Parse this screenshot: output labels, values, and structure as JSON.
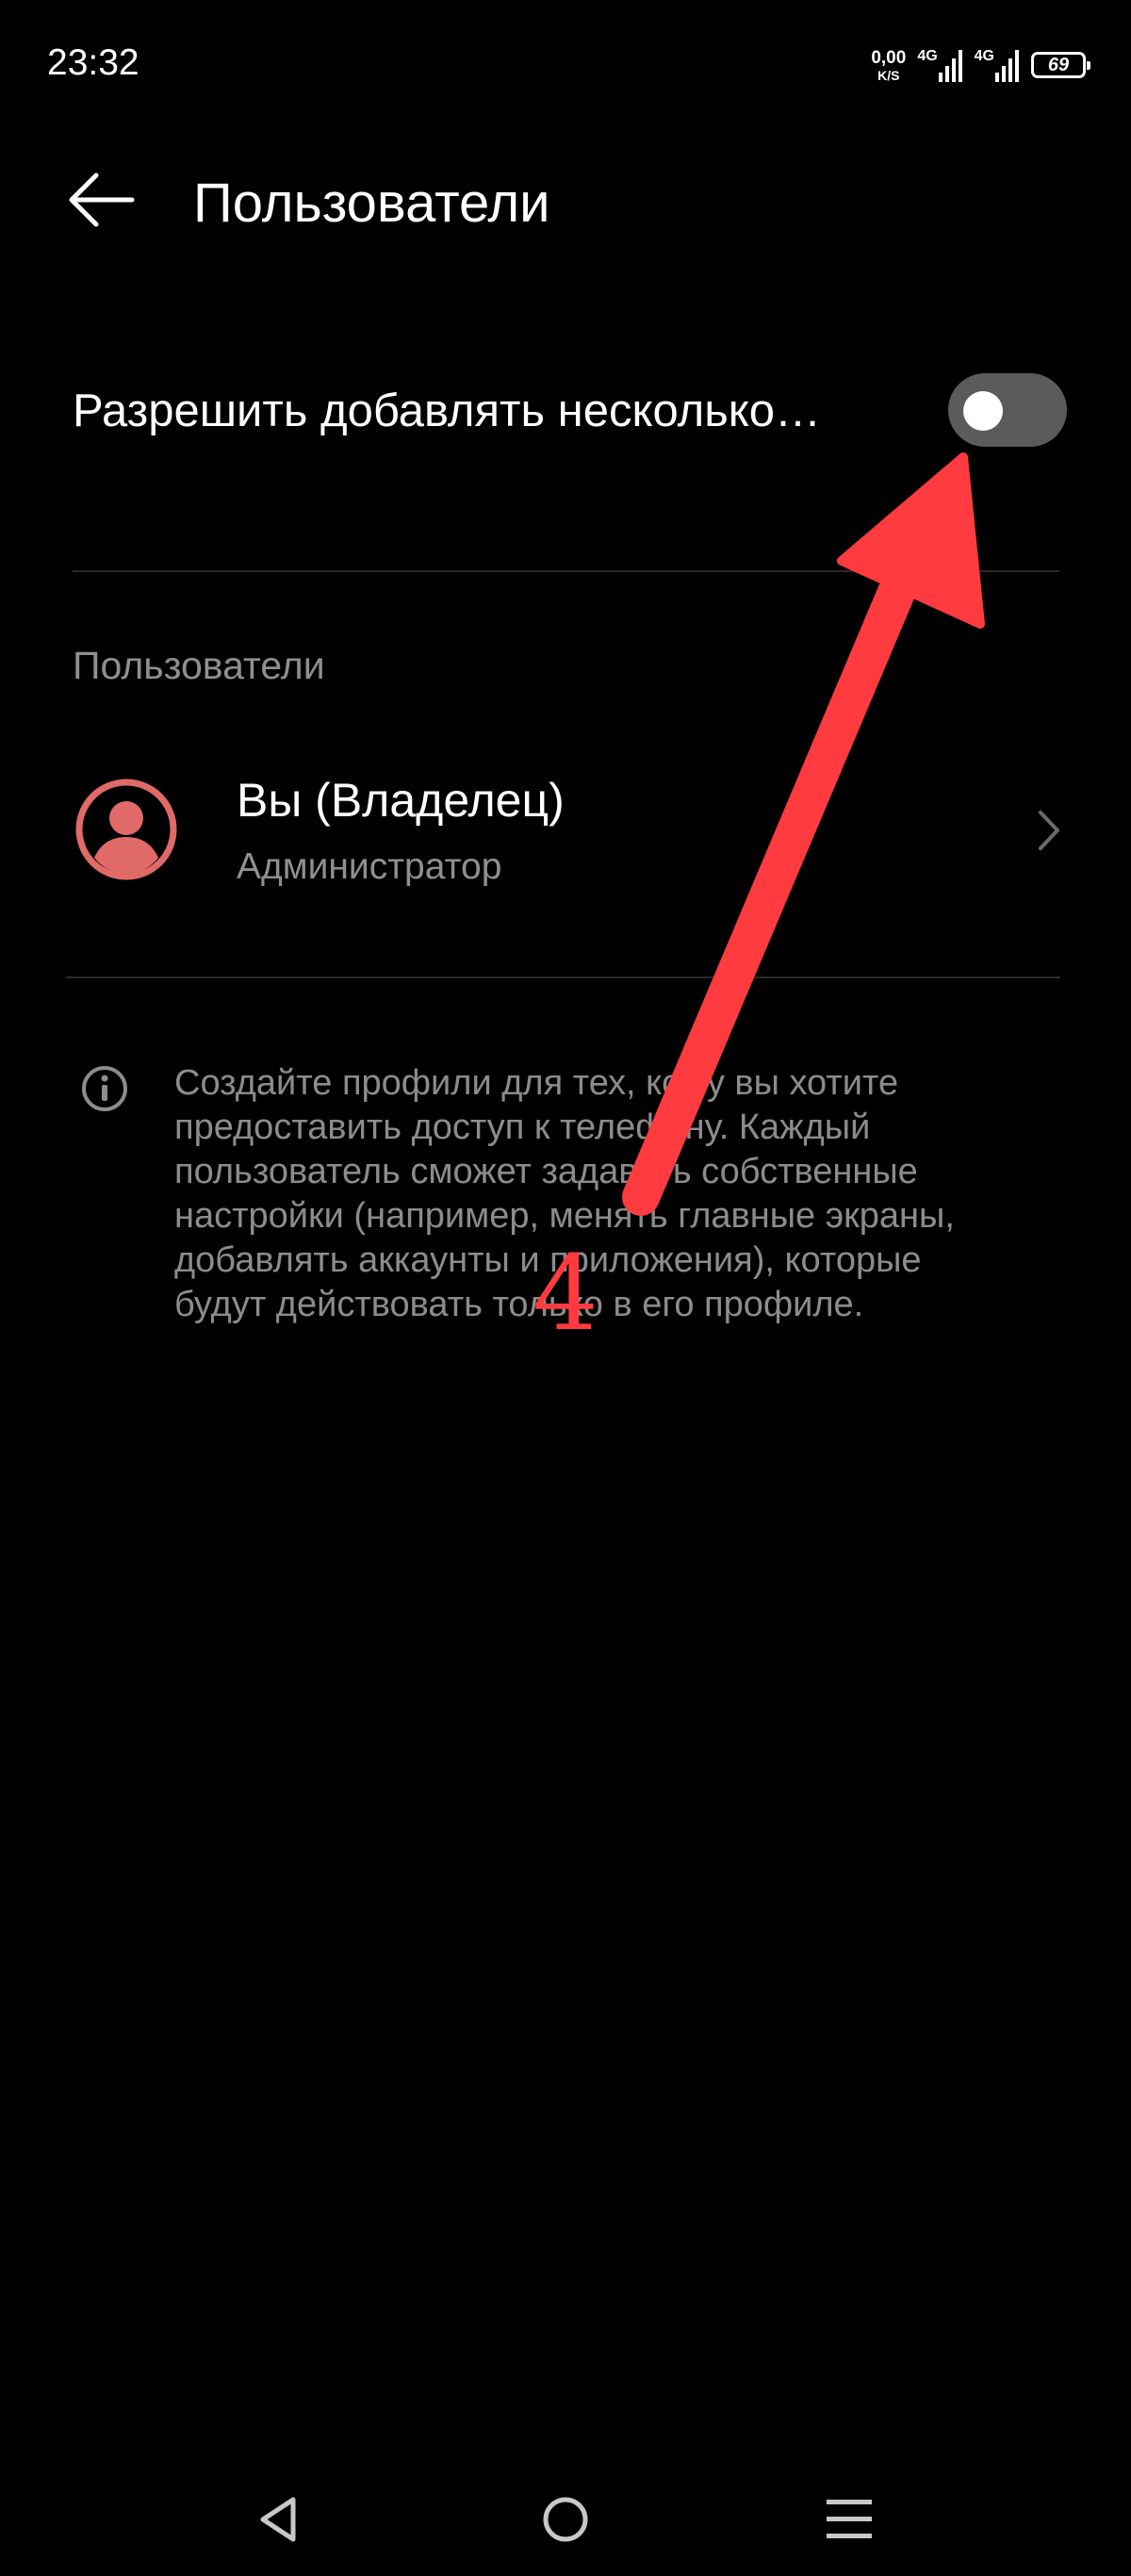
{
  "status_bar": {
    "time": "23:32",
    "net_speed_value": "0,00",
    "net_speed_unit": "K/S",
    "signal1_label": "4G",
    "signal2_label": "4G",
    "battery_level": "69"
  },
  "header": {
    "back_icon": "arrow-left-icon",
    "title": "Пользователи"
  },
  "multi_user_toggle": {
    "label": "Разрешить добавлять несколько…",
    "enabled": false
  },
  "users_section": {
    "header": "Пользователи",
    "users": [
      {
        "name": "Вы (Владелец)",
        "role": "Администратор",
        "avatar_icon": "user-avatar-icon"
      }
    ]
  },
  "info": {
    "icon": "info-icon",
    "lines": [
      "Создайте профили для тех, кому вы хотите",
      "предоставить доступ к телефону. Каждый",
      "пользователь сможет задавать собственные",
      "настройки (например, менять главные экраны,",
      "добавлять аккаунты и приложения), которые",
      "будут действовать только в его профиле."
    ]
  },
  "annotation": {
    "step_number": "4",
    "color": "#ff3b3f"
  },
  "nav_bar": {
    "back_icon": "triangle-back-icon",
    "home_icon": "circle-home-icon",
    "recents_icon": "menu-lines-icon"
  },
  "colors": {
    "background": "#000000",
    "accent": "#e06a68",
    "secondary_text": "#8f8f8f",
    "toggle_off": "#5b5b5b"
  }
}
